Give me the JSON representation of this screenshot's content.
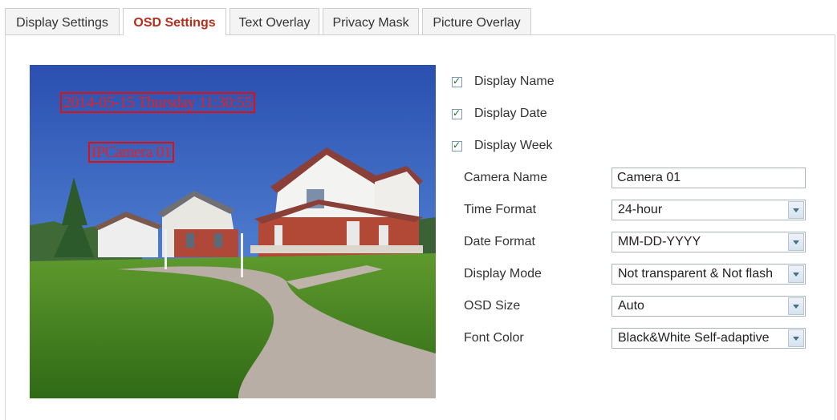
{
  "tabs": [
    {
      "label": "Display Settings",
      "active": false
    },
    {
      "label": "OSD Settings",
      "active": true
    },
    {
      "label": "Text Overlay",
      "active": false
    },
    {
      "label": "Privacy Mask",
      "active": false
    },
    {
      "label": "Picture Overlay",
      "active": false
    }
  ],
  "preview": {
    "osd_datetime": "2014-05-15 Thursday 11:30:55",
    "osd_camera_name": "IPCamera 01",
    "osd_color": "#e01010"
  },
  "checkboxes": {
    "display_name": {
      "label": "Display Name",
      "checked": true
    },
    "display_date": {
      "label": "Display Date",
      "checked": true
    },
    "display_week": {
      "label": "Display Week",
      "checked": true
    }
  },
  "fields": {
    "camera_name": {
      "label": "Camera Name",
      "value": "Camera 01"
    },
    "time_format": {
      "label": "Time Format",
      "value": "24-hour"
    },
    "date_format": {
      "label": "Date Format",
      "value": "MM-DD-YYYY"
    },
    "display_mode": {
      "label": "Display Mode",
      "value": "Not transparent & Not flash"
    },
    "osd_size": {
      "label": "OSD Size",
      "value": "Auto"
    },
    "font_color": {
      "label": "Font Color",
      "value": "Black&White Self-adaptive"
    }
  },
  "colors": {
    "active_tab_text": "#b52d1b",
    "checkbox_tick": "#1c6d2a"
  }
}
